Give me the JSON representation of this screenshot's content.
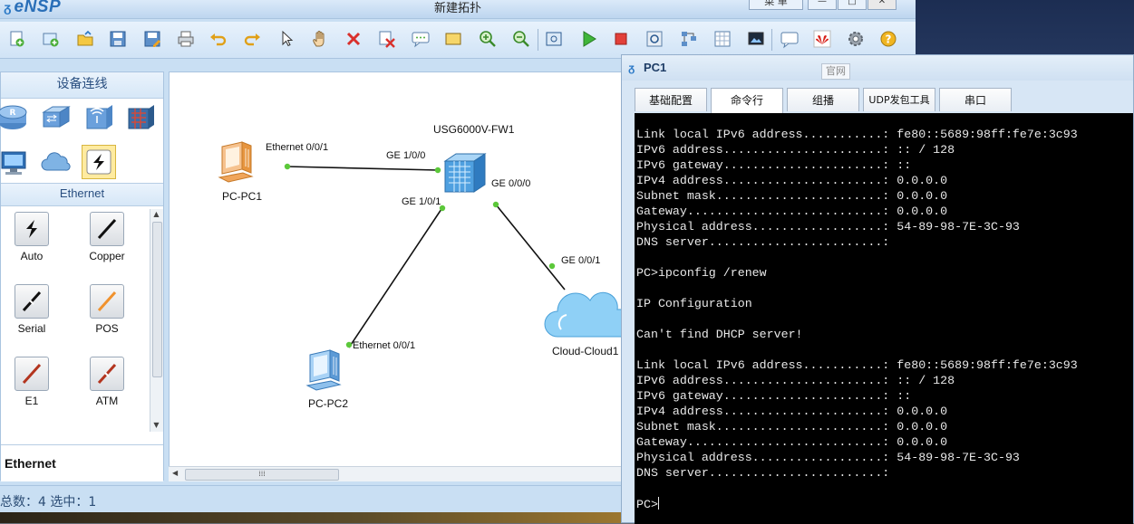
{
  "app": {
    "name": "eNSP",
    "document_title": "新建拓扑",
    "menu_label": "菜 单",
    "window_controls": {
      "minimize": "—",
      "maximize": "□",
      "close": "✕"
    }
  },
  "toolbar": {
    "buttons": [
      "new-topology",
      "new-lab",
      "open",
      "save",
      "save-as",
      "print",
      "undo",
      "redo",
      "select",
      "pan",
      "delete",
      "delete-all",
      "add-note",
      "add-rectangle",
      "zoom-in",
      "zoom-out",
      "fit-view",
      "start-devices",
      "stop-devices",
      "capture-data",
      "topology",
      "grid",
      "screenshot",
      "chat",
      "huawei",
      "settings",
      "help"
    ]
  },
  "device_panel": {
    "header": "设备连线",
    "categories": [
      "router",
      "switch",
      "wireless",
      "firewall",
      "pc",
      "cloud",
      "cable"
    ],
    "selected_category": "cable",
    "subheader": "Ethernet",
    "cables": [
      {
        "label": "Auto",
        "color": "#111111",
        "style": "auto"
      },
      {
        "label": "Copper",
        "color": "#111111",
        "style": "line"
      },
      {
        "label": "Serial",
        "color": "#111111",
        "style": "serial"
      },
      {
        "label": "POS",
        "color": "#f0922e",
        "style": "line"
      },
      {
        "label": "E1",
        "color": "#b3351f",
        "style": "line"
      },
      {
        "label": "ATM",
        "color": "#b3351f",
        "style": "atm"
      }
    ],
    "selected_name": "Ethernet"
  },
  "topology": {
    "devices": [
      {
        "name": "PC-PC1",
        "type": "pc-orange"
      },
      {
        "name": "USG6000V-FW1",
        "type": "firewall"
      },
      {
        "name": "PC-PC2",
        "type": "pc-blue"
      },
      {
        "name": "Cloud-Cloud1",
        "type": "cloud"
      }
    ],
    "ports": [
      "Ethernet 0/0/1",
      "GE 1/0/0",
      "GE 1/0/1",
      "GE 0/0/0",
      "GE 0/0/1",
      "Ethernet 0/0/1"
    ],
    "link_color": "#111111",
    "port_dot_color": "#5cc83a"
  },
  "statusbar": {
    "text": "总数：4 选中：1"
  },
  "pc_window": {
    "title": "PC1",
    "tooltip": "官网",
    "tabs": [
      "基础配置",
      "命令行",
      "组播",
      "UDP发包工具",
      "串口"
    ],
    "active_tab": "命令行",
    "console_lines": [
      "Link local IPv6 address...........: fe80::5689:98ff:fe7e:3c93",
      "IPv6 address......................: :: / 128",
      "IPv6 gateway......................: ::",
      "IPv4 address......................: 0.0.0.0",
      "Subnet mask.......................: 0.0.0.0",
      "Gateway...........................: 0.0.0.0",
      "Physical address..................: 54-89-98-7E-3C-93",
      "DNS server........................:",
      "",
      "PC>ipconfig /renew",
      "",
      "IP Configuration",
      "",
      "Can't find DHCP server!",
      "",
      "Link local IPv6 address...........: fe80::5689:98ff:fe7e:3c93",
      "IPv6 address......................: :: / 128",
      "IPv6 gateway......................: ::",
      "IPv4 address......................: 0.0.0.0",
      "Subnet mask.......................: 0.0.0.0",
      "Gateway...........................: 0.0.0.0",
      "Physical address..................: 54-89-98-7E-3C-93",
      "DNS server........................:",
      "",
      "PC>"
    ]
  }
}
